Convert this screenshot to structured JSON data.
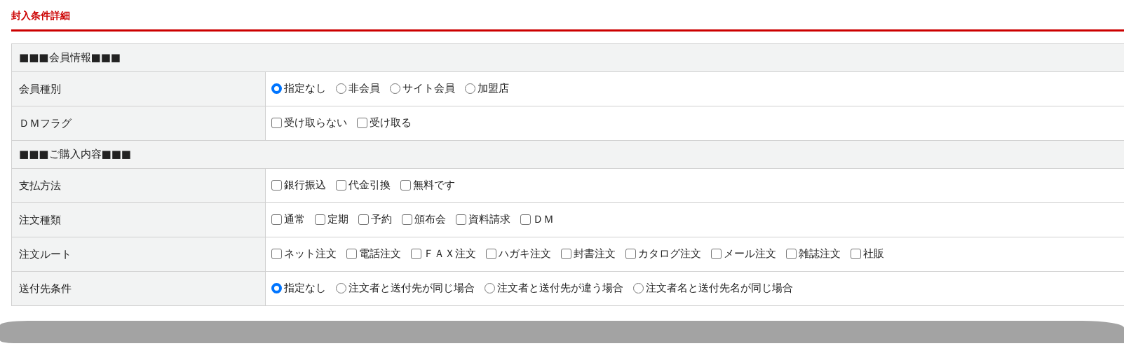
{
  "title": "封入条件詳細",
  "sections": [
    {
      "heading": "■■■会員情報■■■",
      "rows": [
        {
          "label": "会員種別",
          "kind": "radio",
          "options": [
            {
              "label": "指定なし",
              "selected": true
            },
            {
              "label": "非会員",
              "selected": false
            },
            {
              "label": "サイト会員",
              "selected": false
            },
            {
              "label": "加盟店",
              "selected": false
            }
          ]
        },
        {
          "label": "ＤＭフラグ",
          "kind": "checkbox",
          "options": [
            {
              "label": "受け取らない",
              "checked": false
            },
            {
              "label": "受け取る",
              "checked": false
            }
          ]
        }
      ]
    },
    {
      "heading": "■■■ご購入内容■■■",
      "rows": [
        {
          "label": "支払方法",
          "kind": "checkbox",
          "options": [
            {
              "label": "銀行振込",
              "checked": false
            },
            {
              "label": "代金引換",
              "checked": false
            },
            {
              "label": "無料です",
              "checked": false
            }
          ]
        },
        {
          "label": "注文種類",
          "kind": "checkbox",
          "options": [
            {
              "label": "通常",
              "checked": false
            },
            {
              "label": "定期",
              "checked": false
            },
            {
              "label": "予約",
              "checked": false
            },
            {
              "label": "頒布会",
              "checked": false
            },
            {
              "label": "資料請求",
              "checked": false
            },
            {
              "label": "ＤＭ",
              "checked": false
            }
          ]
        },
        {
          "label": "注文ルート",
          "kind": "checkbox",
          "options": [
            {
              "label": "ネット注文",
              "checked": false
            },
            {
              "label": "電話注文",
              "checked": false
            },
            {
              "label": "ＦＡＸ注文",
              "checked": false
            },
            {
              "label": "ハガキ注文",
              "checked": false
            },
            {
              "label": "封書注文",
              "checked": false
            },
            {
              "label": "カタログ注文",
              "checked": false
            },
            {
              "label": "メール注文",
              "checked": false
            },
            {
              "label": "雑誌注文",
              "checked": false
            },
            {
              "label": "社販",
              "checked": false
            }
          ]
        },
        {
          "label": "送付先条件",
          "kind": "radio",
          "options": [
            {
              "label": "指定なし",
              "selected": true
            },
            {
              "label": "注文者と送付先が同じ場合",
              "selected": false
            },
            {
              "label": "注文者と送付先が違う場合",
              "selected": false
            },
            {
              "label": "注文者名と送付先名が同じ場合",
              "selected": false
            }
          ]
        }
      ]
    }
  ]
}
